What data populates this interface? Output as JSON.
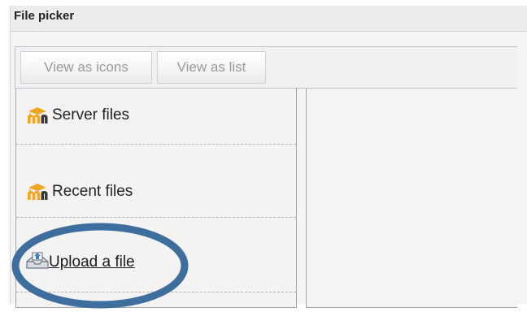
{
  "dialog": {
    "title": "File picker"
  },
  "toolbar": {
    "view_icons_label": "View as icons",
    "view_list_label": "View as list"
  },
  "sidebar": {
    "items": [
      {
        "label": "Server files",
        "icon": "moodle-logo-icon"
      },
      {
        "label": "Recent files",
        "icon": "moodle-logo-icon"
      },
      {
        "label": "Upload a file",
        "icon": "upload-icon"
      }
    ]
  },
  "colors": {
    "logo_orange": "#f1a520",
    "logo_dark": "#3a3a3a",
    "highlight_ring": "#3d6e9e"
  }
}
